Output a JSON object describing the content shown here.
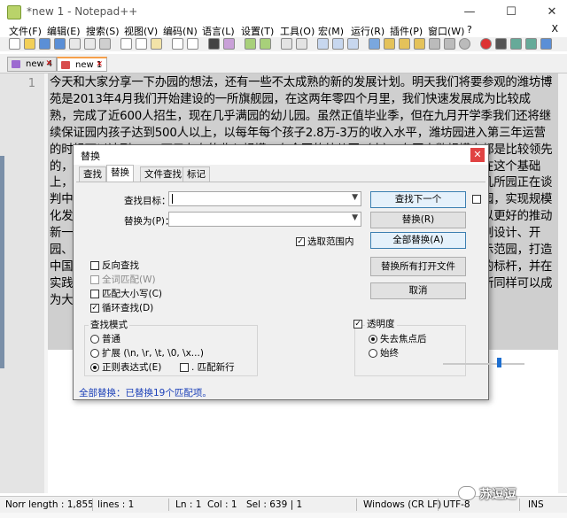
{
  "window": {
    "title": "*new 1 - Notepad++",
    "min": "—",
    "max": "☐",
    "close": "✕"
  },
  "menu": {
    "items": [
      "文件(F)",
      "编辑(E)",
      "搜索(S)",
      "视图(V)",
      "编码(N)",
      "语言(L)",
      "设置(T)",
      "工具(O)",
      "宏(M)",
      "运行(R)",
      "插件(P)",
      "窗口(W)",
      "?"
    ],
    "close": "X"
  },
  "tabs": [
    {
      "label": "new 4",
      "close": "✕",
      "active": false
    },
    {
      "label": "new 1",
      "close": "✕",
      "active": true
    }
  ],
  "editor": {
    "line_number": "1",
    "text": "今天和大家分享一下办园的想法，还有一些不太成熟的新的发展计划。明天我们将要参观的潍坊博苑是2013年4月我们开始建设的一所旗舰园，在这两年零四个月里，我们快速发展成为比较成熟，完成了近600人招生，现在几乎满园的幼儿园。虽然正值毕业季，但在九月开学季我们还将继续保证园内孩子达到500人以上，以每年每个孩子2.8万-3万的收入水平，潍坊园进入第三年运营的时候可以达到1500万元左右的收入规模。在全国的幼儿园（人），在园人数规模上都是比较领先的，在我们家乡上，这所园可以说是我们的领头羊。泰安园开园后也很快达到满园，在这个基础上，我们还在快速扩张，潍坊第二所园、山东淄博正在紧锣密鼓的筹建中，另外还有几所园正在谈判中。在这个过程中，每年的速度，给自己定了新的目标，那就是三年内达到二十所园，实现规模化发展，潍坊、泰安到曲阜三孔景区，我们已经完成了选址，并将在明年开始建设，以更好的推动新一代幼儿园的规划，在规划、建设、运营上都有新的突破，我们从园所的选址、规划设计、开园、运营管理等各个环节形成了一套标准化体系，我们会把这些经验复制到博苑园所示范园，打造中国幼儿教育的知名品牌，我们有信心在未来几年里成为一个中国幼儿园园长心目中的标杆，并在实践中不断改进，持续创新，希望明年的今天是泰山脚下，曲阜孔子故里，我们的园所同样可以成为大家参观学习的对象，并为地方经济带动当地的人文。"
  },
  "status": {
    "length": "Norr length : 1,855",
    "lines": "lines : 1",
    "ln": "Ln : 1",
    "col": "Col : 1",
    "sel": "Sel : 639 | 1",
    "eol": "Windows (CR LF)",
    "encoding": "UTF-8",
    "mode": "INS"
  },
  "watermark": "苏逗逗",
  "dialog": {
    "title": "替换",
    "close": "✕",
    "tabs": [
      "查找",
      "替换",
      "文件查找",
      "标记"
    ],
    "find_label": "查找目标：",
    "find_value": "",
    "replace_label": "替换为(P)：",
    "replace_value": "",
    "in_selection": "选取范围内",
    "buttons": {
      "find_next": "查找下一个",
      "replace": "替换(R)",
      "replace_all": "全部替换(A)",
      "replace_all_open": "替换所有打开文件",
      "cancel": "取消"
    },
    "options": {
      "backward": "反向查找",
      "whole_word": "全词匹配(W)",
      "match_case": "匹配大小写(C)",
      "wrap": "循环查找(D)"
    },
    "search_mode": {
      "title": "查找模式",
      "normal": "普通",
      "extended": "扩展 (\\n, \\r, \\t, \\0, \\x...)",
      "regex": "正则表达式(E)",
      "dot_newline": ". 匹配新行"
    },
    "transparency": {
      "title": "透明度",
      "on_lose_focus": "失去焦点后",
      "always": "始终",
      "level": 0.7
    },
    "status": "全部替换：已替换19个匹配项。"
  }
}
